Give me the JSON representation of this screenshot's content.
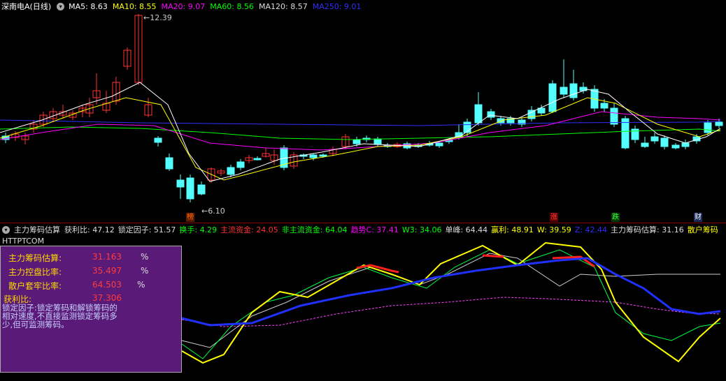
{
  "header": {
    "stock_name": "深南电A(日线)",
    "ma": [
      {
        "label": "MA5:",
        "value": "8.63",
        "color": "#ffffff"
      },
      {
        "label": "MA10:",
        "value": "8.55",
        "color": "#ffff00"
      },
      {
        "label": "MA20:",
        "value": "9.07",
        "color": "#ff00ff"
      },
      {
        "label": "MA60:",
        "value": "8.56",
        "color": "#00ff00"
      },
      {
        "label": "MA120:",
        "value": "8.57",
        "color": "#dddddd"
      },
      {
        "label": "MA250:",
        "value": "9.01",
        "color": "#3030ff"
      }
    ]
  },
  "price_labels": {
    "high": "12.39",
    "low": "6.10"
  },
  "event_markers": [
    {
      "label": "榜",
      "color": "#ff6a00",
      "bg": "#5a1a00"
    },
    {
      "label": "涨",
      "color": "#ff4040",
      "bg": "#5a0000"
    },
    {
      "label": "跌",
      "color": "#40ff40",
      "bg": "#003a00"
    },
    {
      "label": "财",
      "color": "#ffffff",
      "bg": "#1a2a5a"
    }
  ],
  "indicator": {
    "name": "主力筹码估算",
    "items": [
      {
        "label": "获利比:",
        "value": "47.12",
        "color": "#dddddd"
      },
      {
        "label": "锁定因子:",
        "value": "51.57",
        "color": "#dddddd"
      },
      {
        "label": "换手:",
        "value": "4.29",
        "color": "#00ff00"
      },
      {
        "label": "主流资金:",
        "value": "24.05",
        "color": "#ff3030"
      },
      {
        "label": "非主流资金:",
        "value": "64.04",
        "color": "#00ff00"
      },
      {
        "label": "趋势C:",
        "value": "37.41",
        "color": "#ff00ff"
      },
      {
        "label": "W3:",
        "value": "34.06",
        "color": "#00ff00"
      },
      {
        "label": "单峰:",
        "value": "64.44",
        "color": "#dddddd"
      },
      {
        "label": "赢利:",
        "value": "48.91",
        "color": "#ffff00"
      },
      {
        "label": "W:",
        "value": "39.59",
        "color": "#ffff00"
      },
      {
        "label": "Z:",
        "value": "42.44",
        "color": "#3030ff"
      },
      {
        "label": "主力筹码估算:",
        "value": "31.16",
        "color": "#dddddd"
      },
      {
        "label": "散户筹码",
        "value": "",
        "color": "#ffff00"
      }
    ]
  },
  "panel": {
    "website": "HTTPTCOM",
    "rows": [
      {
        "label": "主力筹码估算:",
        "value": "31.163",
        "unit": "%"
      },
      {
        "label": "主力控盘比率:",
        "value": "35.497",
        "unit": "%"
      },
      {
        "label": "散户套牢比率:",
        "value": "64.503",
        "unit": "%"
      }
    ],
    "profit_label": "获利比:",
    "profit_value": "37.306",
    "description": "锁定因子:锁定筹码和解锁筹码的相对速度,不直接监测锁定筹码多少,但可监测筹码。"
  },
  "colors": {
    "up": "#ff3232",
    "down": "#54ffff",
    "bg": "#000000",
    "panel_bg": "#5a1a78"
  }
}
